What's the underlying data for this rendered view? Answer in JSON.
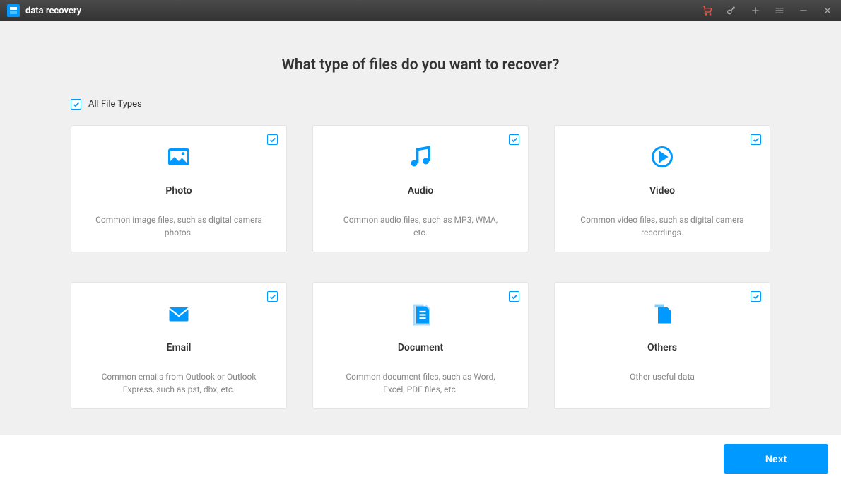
{
  "app": {
    "title": "data recovery"
  },
  "page": {
    "title": "What type of files do you want to recover?",
    "all_types_label": "All File Types",
    "all_types_checked": true
  },
  "cards": [
    {
      "title": "Photo",
      "desc": "Common image files, such as digital camera photos.",
      "icon": "photo",
      "checked": true
    },
    {
      "title": "Audio",
      "desc": "Common audio files, such as MP3, WMA, etc.",
      "icon": "audio",
      "checked": true
    },
    {
      "title": "Video",
      "desc": "Common video files, such as digital camera recordings.",
      "icon": "video",
      "checked": true
    },
    {
      "title": "Email",
      "desc": "Common emails from Outlook or Outlook Express, such as pst, dbx, etc.",
      "icon": "email",
      "checked": true
    },
    {
      "title": "Document",
      "desc": "Common document files, such as Word, Excel, PDF files, etc.",
      "icon": "document",
      "checked": true
    },
    {
      "title": "Others",
      "desc": "Other useful data",
      "icon": "others",
      "checked": true
    }
  ],
  "footer": {
    "next_label": "Next"
  },
  "colors": {
    "accent": "#0099ff",
    "cart": "#ff4d3a"
  }
}
